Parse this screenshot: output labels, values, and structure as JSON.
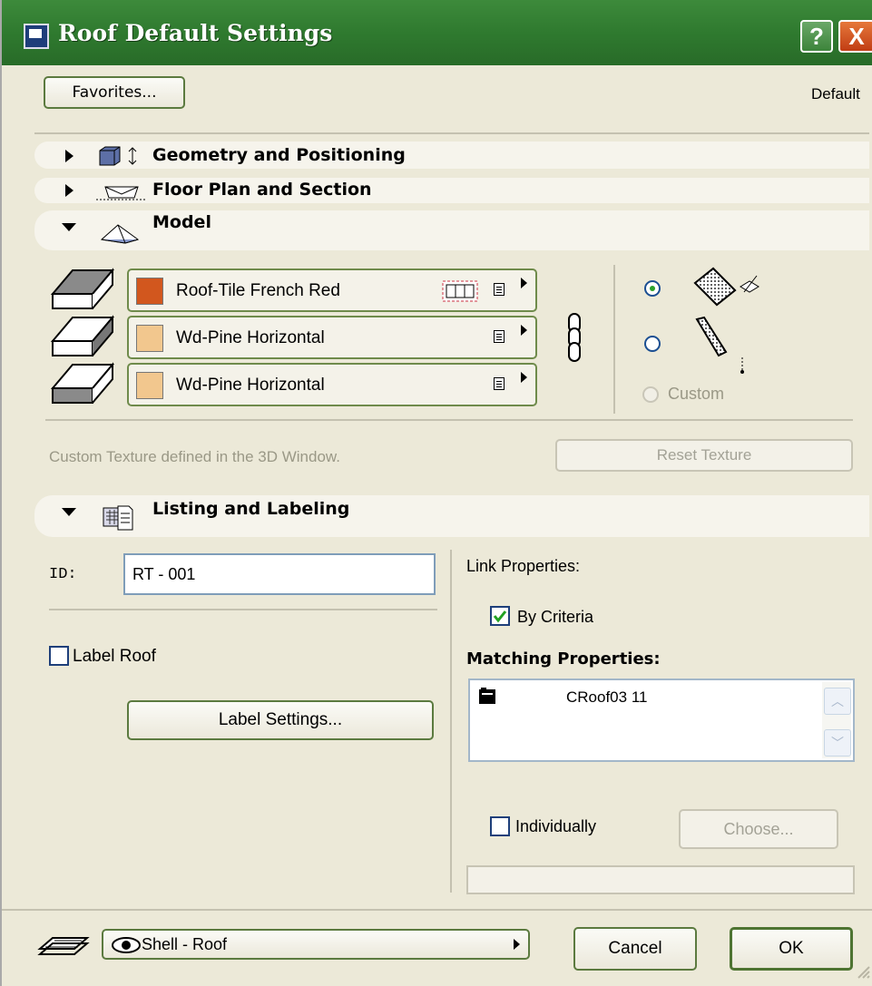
{
  "window": {
    "title": "Roof Default Settings",
    "help_glyph": "?",
    "close_glyph": "X"
  },
  "top": {
    "favorites_label": "Favorites...",
    "default_label": "Default"
  },
  "panels": {
    "geometry": "Geometry and Positioning",
    "floorplan": "Floor Plan and Section",
    "model": "Model",
    "listing": "Listing and Labeling"
  },
  "model": {
    "materials": [
      {
        "name": "Roof-Tile French Red",
        "color": "#d2571e"
      },
      {
        "name": "Wd-Pine Horizontal",
        "color": "#f2c78e"
      },
      {
        "name": "Wd-Pine Horizontal",
        "color": "#f2c78e"
      }
    ],
    "custom_label": "Custom",
    "texture_note": "Custom Texture defined in the 3D Window.",
    "reset_texture_label": "Reset Texture"
  },
  "listing": {
    "id_label": "ID:",
    "id_value": "RT - 001",
    "label_roof": "Label Roof",
    "label_roof_checked": false,
    "label_settings": "Label Settings...",
    "link_properties": "Link Properties:",
    "by_criteria": "By Criteria",
    "by_criteria_checked": true,
    "matching_properties": "Matching Properties:",
    "matching_item": "CRoof03 11",
    "individually": "Individually",
    "individually_checked": false,
    "choose_label": "Choose...",
    "bottom_field_value": ""
  },
  "footer": {
    "layer": "Shell - Roof",
    "cancel": "Cancel",
    "ok": "OK"
  },
  "colors": {
    "title_green": "#2f7a2f",
    "dialog_bg": "#ece9d8",
    "accent_border": "#5b7a3f"
  }
}
